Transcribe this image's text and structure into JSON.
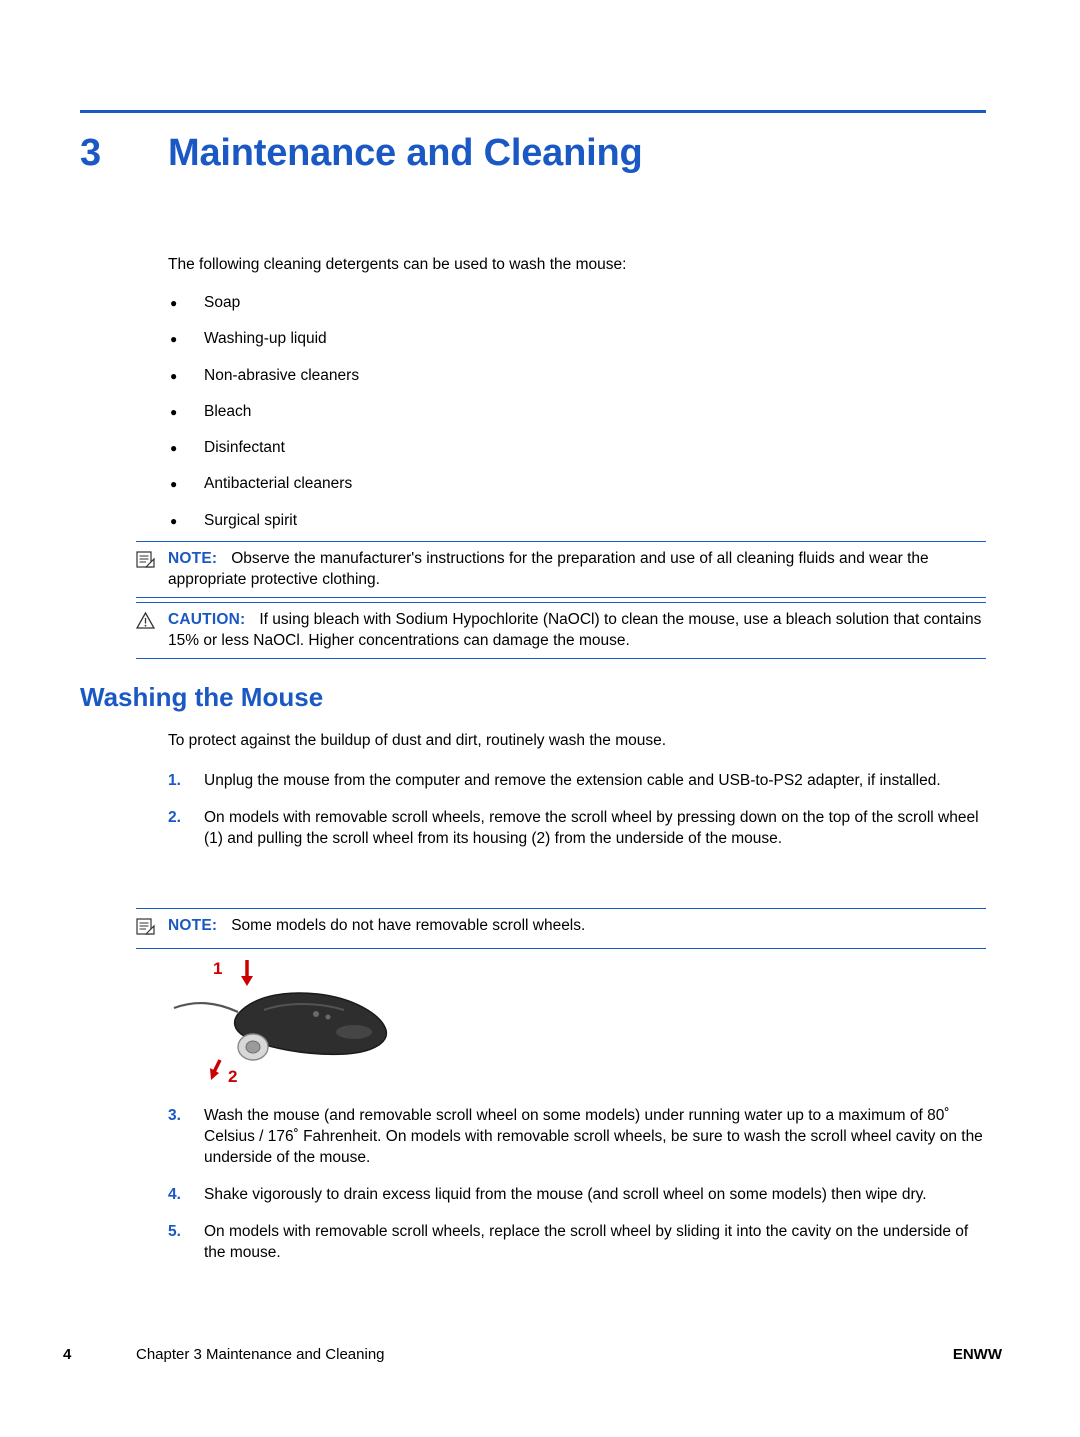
{
  "chapter": {
    "number": "3",
    "title": "Maintenance and Cleaning"
  },
  "intro": "The following cleaning detergents can be used to wash the mouse:",
  "bullets": [
    "Soap",
    "Washing-up liquid",
    "Non-abrasive cleaners",
    "Bleach",
    "Disinfectant",
    "Antibacterial cleaners",
    "Surgical spirit"
  ],
  "note1": {
    "label": "NOTE:",
    "text": "Observe the manufacturer's instructions for the preparation and use of all cleaning fluids and wear the appropriate protective clothing."
  },
  "caution": {
    "label": "CAUTION:",
    "text": "If using bleach with Sodium Hypochlorite (NaOCl) to clean the mouse, use a bleach solution that contains 15% or less NaOCl. Higher concentrations can damage the mouse."
  },
  "section": {
    "heading": "Washing the Mouse",
    "intro": "To protect against the buildup of dust and dirt, routinely wash the mouse."
  },
  "steps": [
    {
      "num": "1.",
      "text": "Unplug the mouse from the computer and remove the extension cable and USB-to-PS2 adapter, if installed."
    },
    {
      "num": "2.",
      "text": "On models with removable scroll wheels, remove the scroll wheel by pressing down on the top of the scroll wheel (1) and pulling the scroll wheel from its housing (2) from the underside of the mouse."
    },
    {
      "num": "3.",
      "text": "Wash the mouse (and removable scroll wheel on some models) under running water up to a maximum of 80˚ Celsius / 176˚ Fahrenheit. On models with removable scroll wheels, be sure to wash the scroll wheel cavity on the underside of the mouse."
    },
    {
      "num": "4.",
      "text": "Shake vigorously to drain excess liquid from the mouse (and scroll wheel on some models) then wipe dry."
    },
    {
      "num": "5.",
      "text": "On models with removable scroll wheels, replace the scroll wheel by sliding it into the cavity on the underside of the mouse."
    }
  ],
  "note2": {
    "label": "NOTE:",
    "text": "Some models do not have removable scroll wheels."
  },
  "figure": {
    "callout_1": "1",
    "callout_2": "2"
  },
  "footer": {
    "page_number": "4",
    "chapter_text": "Chapter 3   Maintenance and Cleaning",
    "locale": "ENWW"
  },
  "colors": {
    "accent": "#1a58c4",
    "callout": "#cc0000"
  }
}
